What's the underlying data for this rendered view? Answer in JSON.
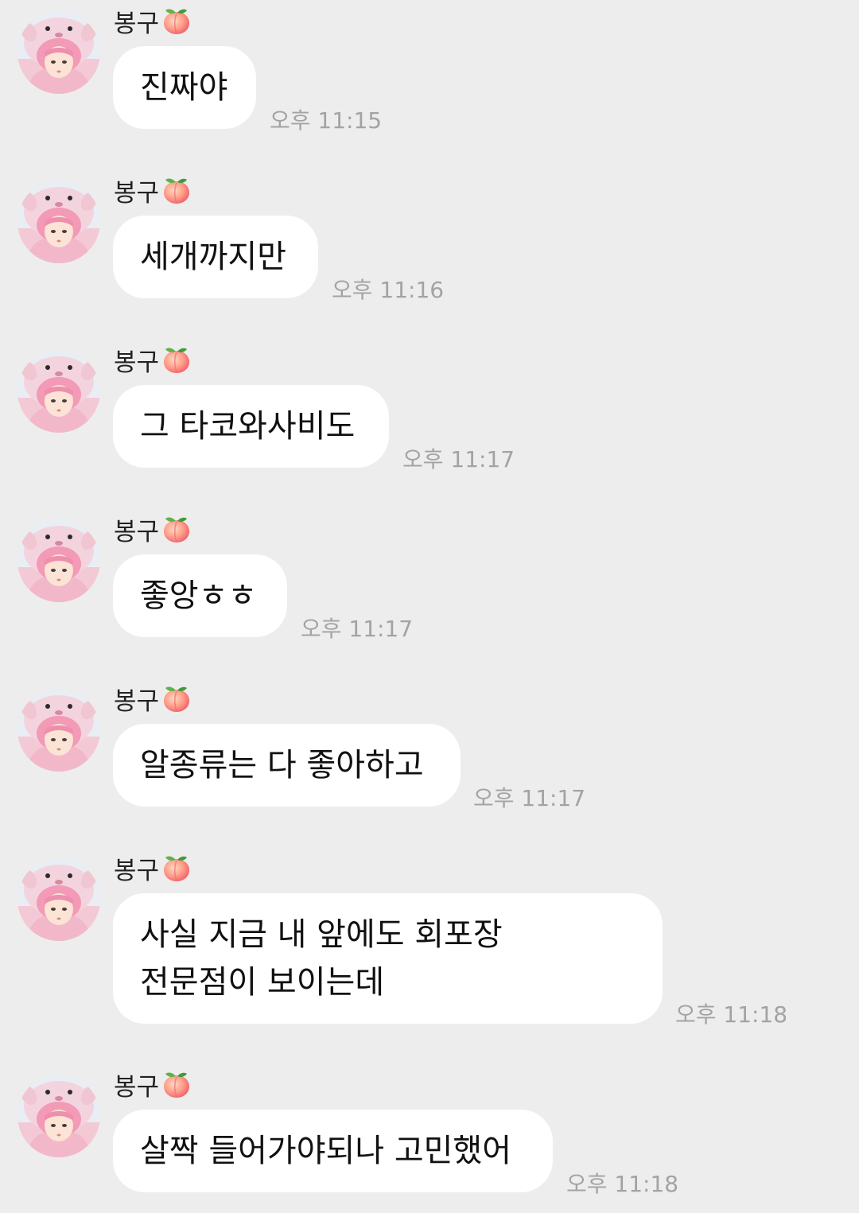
{
  "chat": {
    "sender_name": "봉구",
    "sender_icon": "peach-icon",
    "avatar": "pink-hood-character-avatar",
    "colors": {
      "background": "#ededed",
      "bubble": "#ffffff",
      "timestamp": "#a3a3a3"
    },
    "messages": [
      {
        "lines": [
          "진짜야"
        ],
        "time": "오후 11:15"
      },
      {
        "lines": [
          "세개까지만"
        ],
        "time": "오후 11:16"
      },
      {
        "lines": [
          "그 타코와사비도"
        ],
        "time": "오후 11:17"
      },
      {
        "lines": [
          "좋앙ㅎㅎ"
        ],
        "time": "오후 11:17"
      },
      {
        "lines": [
          "알종류는 다 좋아하고"
        ],
        "time": "오후 11:17"
      },
      {
        "lines": [
          "사실 지금 내 앞에도 회포장",
          "전문점이 보이는데"
        ],
        "time": "오후 11:18"
      },
      {
        "lines": [
          "살짝 들어가야되나 고민했어"
        ],
        "time": "오후 11:18"
      }
    ]
  }
}
